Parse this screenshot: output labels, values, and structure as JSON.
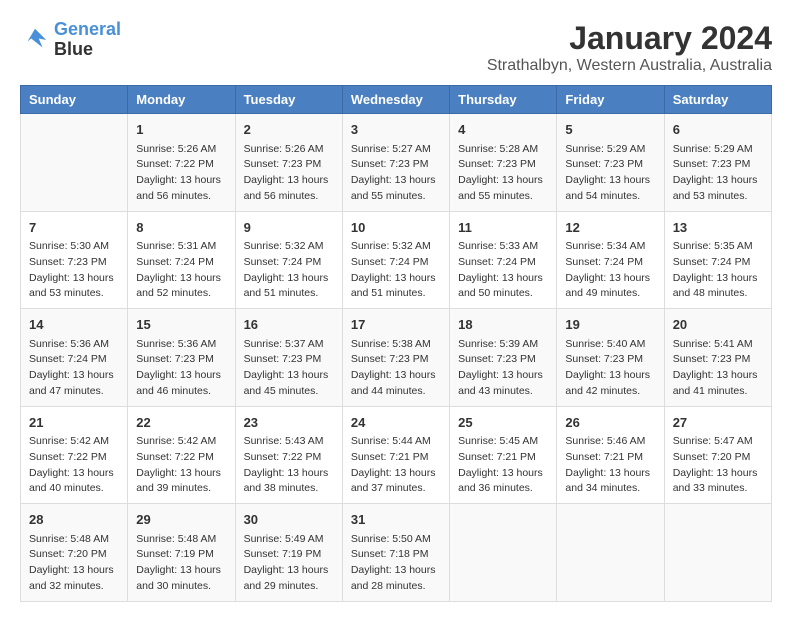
{
  "header": {
    "logo_line1": "General",
    "logo_line2": "Blue",
    "main_title": "January 2024",
    "subtitle": "Strathalbyn, Western Australia, Australia"
  },
  "calendar": {
    "days_of_week": [
      "Sunday",
      "Monday",
      "Tuesday",
      "Wednesday",
      "Thursday",
      "Friday",
      "Saturday"
    ],
    "weeks": [
      [
        {
          "day": "",
          "info": ""
        },
        {
          "day": "1",
          "info": "Sunrise: 5:26 AM\nSunset: 7:22 PM\nDaylight: 13 hours\nand 56 minutes."
        },
        {
          "day": "2",
          "info": "Sunrise: 5:26 AM\nSunset: 7:23 PM\nDaylight: 13 hours\nand 56 minutes."
        },
        {
          "day": "3",
          "info": "Sunrise: 5:27 AM\nSunset: 7:23 PM\nDaylight: 13 hours\nand 55 minutes."
        },
        {
          "day": "4",
          "info": "Sunrise: 5:28 AM\nSunset: 7:23 PM\nDaylight: 13 hours\nand 55 minutes."
        },
        {
          "day": "5",
          "info": "Sunrise: 5:29 AM\nSunset: 7:23 PM\nDaylight: 13 hours\nand 54 minutes."
        },
        {
          "day": "6",
          "info": "Sunrise: 5:29 AM\nSunset: 7:23 PM\nDaylight: 13 hours\nand 53 minutes."
        }
      ],
      [
        {
          "day": "7",
          "info": "Sunrise: 5:30 AM\nSunset: 7:23 PM\nDaylight: 13 hours\nand 53 minutes."
        },
        {
          "day": "8",
          "info": "Sunrise: 5:31 AM\nSunset: 7:24 PM\nDaylight: 13 hours\nand 52 minutes."
        },
        {
          "day": "9",
          "info": "Sunrise: 5:32 AM\nSunset: 7:24 PM\nDaylight: 13 hours\nand 51 minutes."
        },
        {
          "day": "10",
          "info": "Sunrise: 5:32 AM\nSunset: 7:24 PM\nDaylight: 13 hours\nand 51 minutes."
        },
        {
          "day": "11",
          "info": "Sunrise: 5:33 AM\nSunset: 7:24 PM\nDaylight: 13 hours\nand 50 minutes."
        },
        {
          "day": "12",
          "info": "Sunrise: 5:34 AM\nSunset: 7:24 PM\nDaylight: 13 hours\nand 49 minutes."
        },
        {
          "day": "13",
          "info": "Sunrise: 5:35 AM\nSunset: 7:24 PM\nDaylight: 13 hours\nand 48 minutes."
        }
      ],
      [
        {
          "day": "14",
          "info": "Sunrise: 5:36 AM\nSunset: 7:24 PM\nDaylight: 13 hours\nand 47 minutes."
        },
        {
          "day": "15",
          "info": "Sunrise: 5:36 AM\nSunset: 7:23 PM\nDaylight: 13 hours\nand 46 minutes."
        },
        {
          "day": "16",
          "info": "Sunrise: 5:37 AM\nSunset: 7:23 PM\nDaylight: 13 hours\nand 45 minutes."
        },
        {
          "day": "17",
          "info": "Sunrise: 5:38 AM\nSunset: 7:23 PM\nDaylight: 13 hours\nand 44 minutes."
        },
        {
          "day": "18",
          "info": "Sunrise: 5:39 AM\nSunset: 7:23 PM\nDaylight: 13 hours\nand 43 minutes."
        },
        {
          "day": "19",
          "info": "Sunrise: 5:40 AM\nSunset: 7:23 PM\nDaylight: 13 hours\nand 42 minutes."
        },
        {
          "day": "20",
          "info": "Sunrise: 5:41 AM\nSunset: 7:23 PM\nDaylight: 13 hours\nand 41 minutes."
        }
      ],
      [
        {
          "day": "21",
          "info": "Sunrise: 5:42 AM\nSunset: 7:22 PM\nDaylight: 13 hours\nand 40 minutes."
        },
        {
          "day": "22",
          "info": "Sunrise: 5:42 AM\nSunset: 7:22 PM\nDaylight: 13 hours\nand 39 minutes."
        },
        {
          "day": "23",
          "info": "Sunrise: 5:43 AM\nSunset: 7:22 PM\nDaylight: 13 hours\nand 38 minutes."
        },
        {
          "day": "24",
          "info": "Sunrise: 5:44 AM\nSunset: 7:21 PM\nDaylight: 13 hours\nand 37 minutes."
        },
        {
          "day": "25",
          "info": "Sunrise: 5:45 AM\nSunset: 7:21 PM\nDaylight: 13 hours\nand 36 minutes."
        },
        {
          "day": "26",
          "info": "Sunrise: 5:46 AM\nSunset: 7:21 PM\nDaylight: 13 hours\nand 34 minutes."
        },
        {
          "day": "27",
          "info": "Sunrise: 5:47 AM\nSunset: 7:20 PM\nDaylight: 13 hours\nand 33 minutes."
        }
      ],
      [
        {
          "day": "28",
          "info": "Sunrise: 5:48 AM\nSunset: 7:20 PM\nDaylight: 13 hours\nand 32 minutes."
        },
        {
          "day": "29",
          "info": "Sunrise: 5:48 AM\nSunset: 7:19 PM\nDaylight: 13 hours\nand 30 minutes."
        },
        {
          "day": "30",
          "info": "Sunrise: 5:49 AM\nSunset: 7:19 PM\nDaylight: 13 hours\nand 29 minutes."
        },
        {
          "day": "31",
          "info": "Sunrise: 5:50 AM\nSunset: 7:18 PM\nDaylight: 13 hours\nand 28 minutes."
        },
        {
          "day": "",
          "info": ""
        },
        {
          "day": "",
          "info": ""
        },
        {
          "day": "",
          "info": ""
        }
      ]
    ]
  }
}
